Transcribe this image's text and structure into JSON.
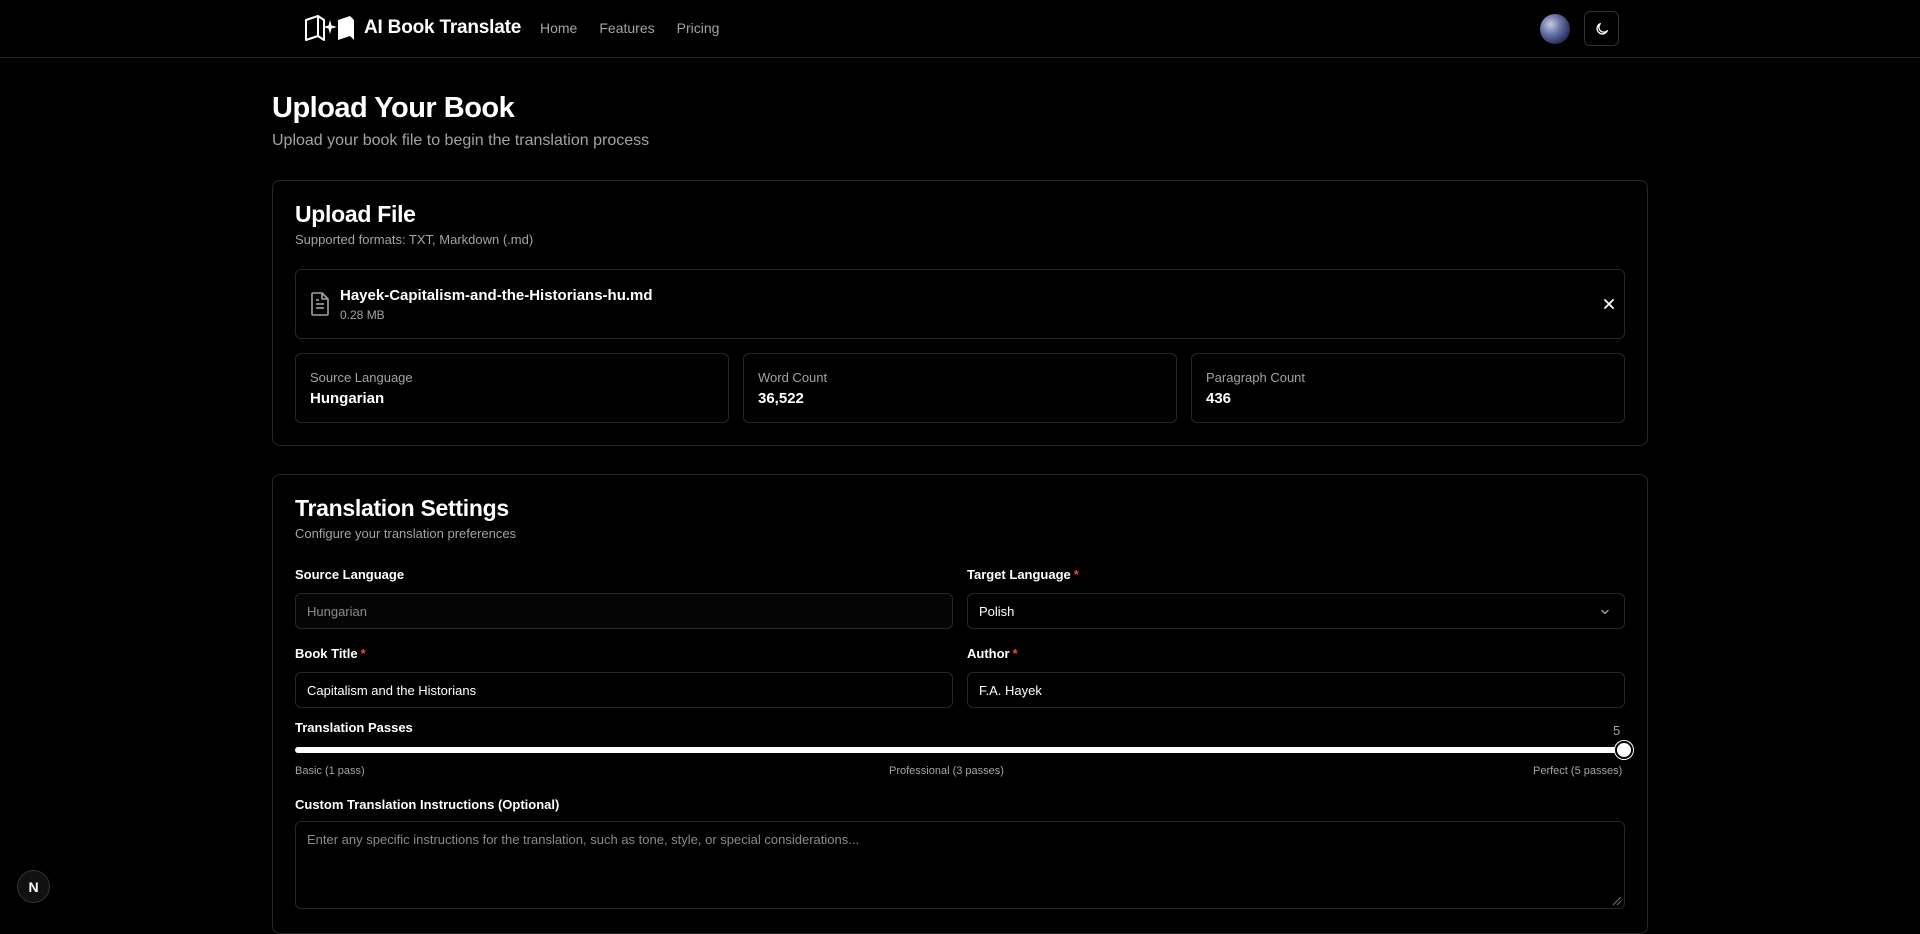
{
  "header": {
    "brand_name": "AI Book Translate",
    "nav": [
      {
        "label": "Home"
      },
      {
        "label": "Features"
      },
      {
        "label": "Pricing"
      }
    ]
  },
  "page": {
    "title": "Upload Your Book",
    "subtitle": "Upload your book file to begin the translation process"
  },
  "upload": {
    "title": "Upload File",
    "description": "Supported formats: TXT, Markdown (.md)",
    "file": {
      "name": "Hayek-Capitalism-and-the-Historians-hu.md",
      "size": "0.28 MB"
    },
    "stats": [
      {
        "label": "Source Language",
        "value": "Hungarian"
      },
      {
        "label": "Word Count",
        "value": "36,522"
      },
      {
        "label": "Paragraph Count",
        "value": "436"
      }
    ]
  },
  "settings": {
    "title": "Translation Settings",
    "description": "Configure your translation preferences",
    "source_language": {
      "label": "Source Language",
      "value": "Hungarian"
    },
    "target_language": {
      "label": "Target Language",
      "required": "*",
      "value": "Polish"
    },
    "book_title": {
      "label": "Book Title",
      "required": "*",
      "value": "Capitalism and the Historians"
    },
    "author": {
      "label": "Author",
      "required": "*",
      "value": "F.A. Hayek"
    },
    "passes": {
      "label": "Translation Passes",
      "value": "5",
      "min": 1,
      "max": 5,
      "ticks": [
        "Basic (1 pass)",
        "Professional (3 passes)",
        "Perfect (5 passes)"
      ]
    },
    "instructions": {
      "label": "Custom Translation Instructions (Optional)",
      "placeholder": "Enter any specific instructions for the translation, such as tone, style, or special considerations..."
    }
  },
  "dev_badge": {
    "label": "N"
  }
}
